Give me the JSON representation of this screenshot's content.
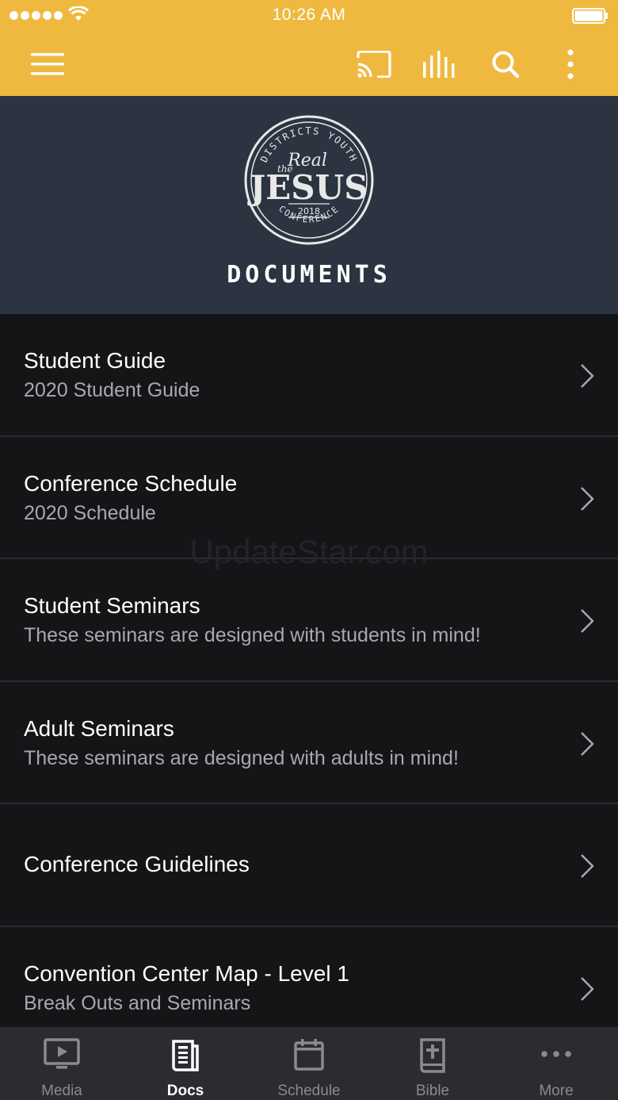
{
  "status_bar": {
    "time": "10:26 AM"
  },
  "header": {
    "title": "DOCUMENTS",
    "logo_text": {
      "arc_top": "DISTRICTS YOUTH",
      "the": "the",
      "real": "Real",
      "main": "JESUS",
      "year": "2018",
      "arc_bottom": "CONFERENCE"
    }
  },
  "watermark": "UpdateStar.com",
  "documents": [
    {
      "title": "Student Guide",
      "subtitle": "2020 Student Guide"
    },
    {
      "title": "Conference Schedule",
      "subtitle": "2020 Schedule"
    },
    {
      "title": "Student Seminars",
      "subtitle": "These seminars are designed with students in mind!"
    },
    {
      "title": "Adult Seminars",
      "subtitle": "These seminars are designed with adults in mind!"
    },
    {
      "title": "Conference Guidelines",
      "subtitle": ""
    },
    {
      "title": "Convention Center Map - Level 1",
      "subtitle": "Break Outs and Seminars"
    }
  ],
  "tabs": [
    {
      "label": "Media",
      "icon": "media-icon"
    },
    {
      "label": "Docs",
      "icon": "docs-icon"
    },
    {
      "label": "Schedule",
      "icon": "schedule-icon"
    },
    {
      "label": "Bible",
      "icon": "bible-icon"
    },
    {
      "label": "More",
      "icon": "more-icon"
    }
  ],
  "colors": {
    "app_bar": "#efb940",
    "header_bg": "#2b3440",
    "list_bg": "#141517",
    "tabbar_bg": "#2a2c30"
  }
}
